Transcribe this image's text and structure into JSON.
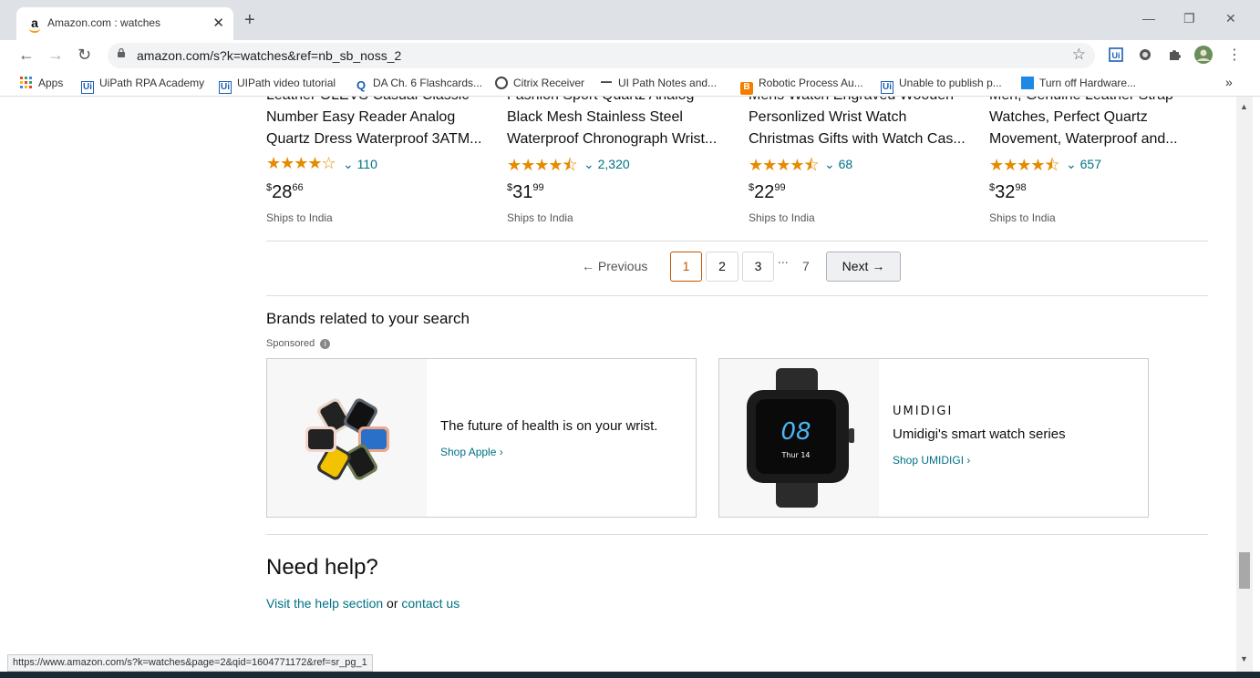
{
  "browser": {
    "tab_title": "Amazon.com : watches",
    "url": "amazon.com/s?k=watches&ref=nb_sb_noss_2",
    "status_url": "https://www.amazon.com/s?k=watches&page=2&qid=1604771172&ref=sr_pg_1"
  },
  "bookmarks": [
    {
      "label": "Apps",
      "icon": "apps-grid-icon"
    },
    {
      "label": "UiPath RPA Academy",
      "icon": "uipath-icon"
    },
    {
      "label": "UIPath video tutorial",
      "icon": "uipath-icon"
    },
    {
      "label": "DA Ch. 6 Flashcards...",
      "icon": "quizlet-icon"
    },
    {
      "label": "Citrix Receiver",
      "icon": "citrix-icon"
    },
    {
      "label": "UI Path Notes and...",
      "icon": "notes-icon"
    },
    {
      "label": "Robotic Process Au...",
      "icon": "blogger-icon"
    },
    {
      "label": "Unable to publish p...",
      "icon": "uipath-icon"
    },
    {
      "label": "Turn off Hardware...",
      "icon": "hardware-icon"
    }
  ],
  "products": [
    {
      "line0": "Leather OLEVS Casual Classic",
      "line1": "Number Easy Reader Analog",
      "line2": "Quartz Dress Waterproof 3ATM...",
      "rating": 4.0,
      "reviews": "110",
      "price_symbol": "$",
      "price_whole": "28",
      "price_frac": "66",
      "ships": "Ships to India"
    },
    {
      "line0": "Fashion Sport Quartz Analog",
      "line1": "Black Mesh Stainless Steel",
      "line2": "Waterproof Chronograph Wrist...",
      "rating": 4.5,
      "reviews": "2,320",
      "price_symbol": "$",
      "price_whole": "31",
      "price_frac": "99",
      "ships": "Ships to India"
    },
    {
      "line0": "Mens Watch Engraved Wooden",
      "line1": "Personlized Wrist Watch",
      "line2": "Christmas Gifts with Watch Cas...",
      "rating": 4.5,
      "reviews": "68",
      "price_symbol": "$",
      "price_whole": "22",
      "price_frac": "99",
      "ships": "Ships to India"
    },
    {
      "line0": "Men, Genuine Leather Strap",
      "line1": "Watches, Perfect Quartz",
      "line2": "Movement, Waterproof and...",
      "rating": 4.5,
      "reviews": "657",
      "price_symbol": "$",
      "price_whole": "32",
      "price_frac": "98",
      "ships": "Ships to India"
    }
  ],
  "pagination": {
    "previous": "← Previous",
    "pages": [
      "1",
      "2",
      "3"
    ],
    "ellipsis": "...",
    "last": "7",
    "next": "Next →",
    "current": "1"
  },
  "brands": {
    "heading": "Brands related to your search",
    "sponsored": "Sponsored",
    "cards": [
      {
        "tagline": "The future of health is on your wrist.",
        "link": "Shop Apple ›",
        "logo": ""
      },
      {
        "tagline": "Umidigi's smart watch series",
        "link": "Shop UMIDIGI ›",
        "logo": "UMIDIGI"
      }
    ]
  },
  "help": {
    "heading": "Need help?",
    "link1": "Visit the help section",
    "or": "or",
    "link2": "contact us"
  },
  "colors": {
    "star": "#e68a00",
    "link": "#007185",
    "selected_page": "#c45500"
  }
}
